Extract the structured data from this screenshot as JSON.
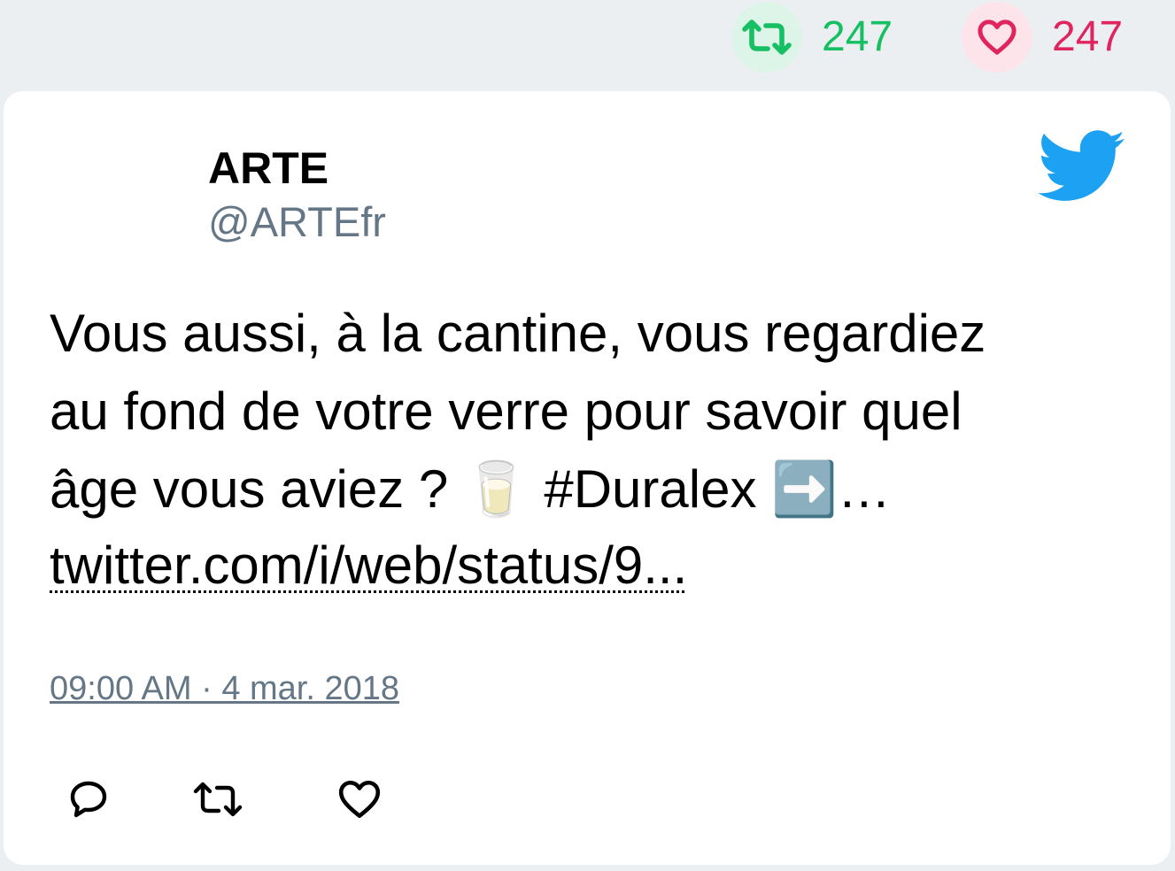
{
  "stats": {
    "retweet_count": "247",
    "like_count": "247",
    "retweet_color": "#17bf63",
    "like_color": "#e0245e"
  },
  "author": {
    "name": "ARTE",
    "handle": "@ARTEfr"
  },
  "tweet": {
    "text": "Vous aussi, à la cantine, vous regardiez\nau fond de votre verre pour savoir quel\nâge vous aviez ? 🥛 #Duralex ➡️…",
    "link": "twitter.com/i/web/status/9...",
    "timestamp": "09:00 AM · 4 mar. 2018"
  },
  "icons": {
    "brand": "twitter-bird-icon",
    "actions": [
      "reply-icon",
      "retweet-icon",
      "like-icon"
    ]
  },
  "colors": {
    "brand_blue": "#1da1f2",
    "muted": "#657786"
  }
}
